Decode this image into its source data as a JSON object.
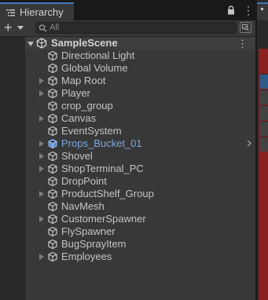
{
  "window": {
    "tab_title": "Hierarchy",
    "tab_icon": "hierarchy-list-icon",
    "lock_icon": "lock-icon",
    "menu_glyph": "⋮"
  },
  "toolbar": {
    "create_glyph": "+",
    "search_placeholder": "All",
    "search_icon": "search-icon",
    "filter_icon": "search-by-type-icon"
  },
  "scene": {
    "name": "SampleScene",
    "icon": "unity-scene-icon",
    "menu_glyph": "⋮",
    "expanded": true
  },
  "items": [
    {
      "label": "Directional Light",
      "foldout": false,
      "prefab": false
    },
    {
      "label": "Global Volume",
      "foldout": false,
      "prefab": false
    },
    {
      "label": "Map Root",
      "foldout": true,
      "prefab": false
    },
    {
      "label": "Player",
      "foldout": true,
      "prefab": false
    },
    {
      "label": "crop_group",
      "foldout": false,
      "prefab": false
    },
    {
      "label": "Canvas",
      "foldout": true,
      "prefab": false
    },
    {
      "label": "EventSystem",
      "foldout": false,
      "prefab": false
    },
    {
      "label": "Props_Bucket_01",
      "foldout": true,
      "prefab": true
    },
    {
      "label": "Shovel",
      "foldout": true,
      "prefab": false
    },
    {
      "label": "ShopTerminal_PC",
      "foldout": true,
      "prefab": false
    },
    {
      "label": "DropPoint",
      "foldout": false,
      "prefab": false
    },
    {
      "label": "ProductShelf_Group",
      "foldout": true,
      "prefab": false
    },
    {
      "label": "NavMesh",
      "foldout": false,
      "prefab": false
    },
    {
      "label": "CustomerSpawner",
      "foldout": true,
      "prefab": false
    },
    {
      "label": "FlySpawner",
      "foldout": false,
      "prefab": false
    },
    {
      "label": "BugSprayItem",
      "foldout": false,
      "prefab": false
    },
    {
      "label": "Employees",
      "foldout": true,
      "prefab": false
    }
  ],
  "colors": {
    "tab_accent": "#3a79bb",
    "prefab_text": "#7ca6e0",
    "panel_bg": "#383838"
  }
}
